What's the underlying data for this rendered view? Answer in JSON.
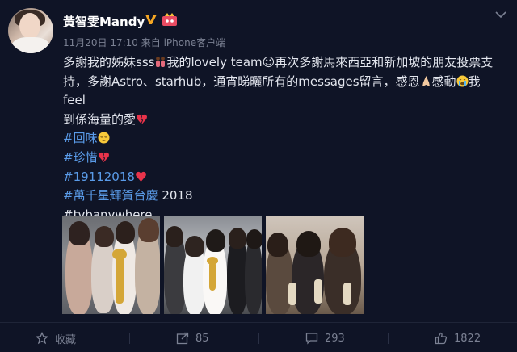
{
  "post": {
    "author": "黃智雯Mandy",
    "meta": "11月20日 17:10 来自 iPhone客户端",
    "content": {
      "line1_a": "多謝我的姊妹sss",
      "line1_b": "我的lovely team☺再次多謝馬來西亞和新加坡的朋友投票支",
      "line2_a": "持，多謝Astro、starhub，通宵睇曬所有的messages留言，感恩",
      "line2_b": "感動",
      "line2_c": "我feel",
      "line3": "到係海量的愛",
      "tags": [
        "#回味",
        "#珍惜",
        "#19112018",
        "#萬千星輝賀台慶",
        "#tvbanywhere"
      ],
      "tag4_suffix": " 2018"
    },
    "photos": [
      "photo-1",
      "photo-2",
      "photo-3"
    ]
  },
  "footer": {
    "favorite_label": "收藏",
    "repost_count": "85",
    "comment_count": "293",
    "like_count": "1822"
  },
  "colors": {
    "background": "#0f1426",
    "hashtag": "#5a9be8",
    "verified": "#f5a623",
    "heart": "#e8334a"
  },
  "icons": [
    "verified-icon",
    "vip-icon",
    "chevron-down-icon",
    "star-icon",
    "repost-icon",
    "comment-icon",
    "like-icon"
  ]
}
